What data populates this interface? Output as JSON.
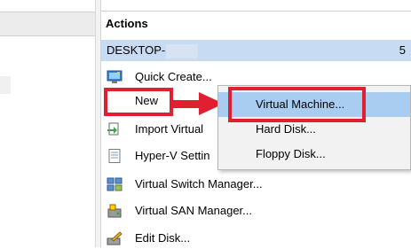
{
  "actions_pane": {
    "title": "Actions",
    "host": {
      "label": "DESKTOP-",
      "trailing": "5"
    },
    "items": [
      {
        "label": "Quick Create...",
        "icon": "quick-create-icon"
      },
      {
        "label": "New",
        "icon": "none"
      },
      {
        "label": "Import Virtual",
        "icon": "import-vm-icon"
      },
      {
        "label": "Hyper-V Settin",
        "icon": "settings-doc-icon"
      },
      {
        "label": "Virtual Switch Manager...",
        "icon": "switch-manager-icon"
      },
      {
        "label": "Virtual SAN Manager...",
        "icon": "san-manager-icon"
      },
      {
        "label": "Edit Disk...",
        "icon": "edit-disk-icon"
      }
    ]
  },
  "new_submenu": {
    "items": [
      {
        "label": "Virtual Machine...",
        "selected": true
      },
      {
        "label": "Hard Disk...",
        "selected": false
      },
      {
        "label": "Floppy Disk...",
        "selected": false
      }
    ]
  },
  "annotations": {
    "highlight_color": "#e02030"
  },
  "colors": {
    "host_bar": "#c7dcf2",
    "menu_selected": "#a9cdf0",
    "menu_bg": "#f2f2f2"
  }
}
